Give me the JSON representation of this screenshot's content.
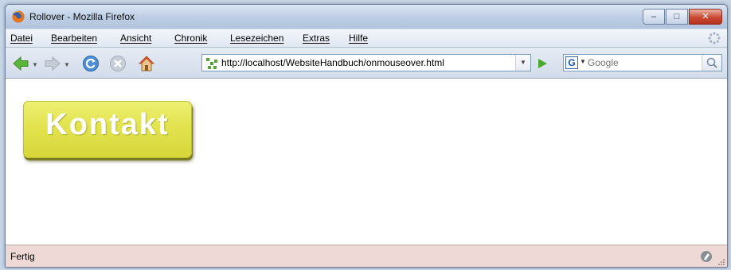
{
  "window": {
    "title": "Rollover - Mozilla Firefox",
    "controls": {
      "minimize": "–",
      "maximize": "□",
      "close": "✕"
    }
  },
  "menubar": {
    "items": [
      "Datei",
      "Bearbeiten",
      "Ansicht",
      "Chronik",
      "Lesezeichen",
      "Extras",
      "Hilfe"
    ]
  },
  "navbar": {
    "url": "http://localhost/WebsiteHandbuch/onmouseover.html",
    "search_engine_letter": "G",
    "search_placeholder": "Google"
  },
  "content": {
    "button_label": "Kontakt",
    "button_color": "#e3e34f"
  },
  "statusbar": {
    "text": "Fertig"
  },
  "icons": {
    "app": "firefox-icon",
    "back": "back-arrow-icon",
    "forward": "forward-arrow-icon",
    "reload": "reload-icon",
    "stop": "stop-icon",
    "home": "home-icon",
    "site": "site-favicon-icon",
    "go": "go-arrow-icon",
    "search": "magnifier-icon",
    "throbber": "throbber-icon",
    "status": "pencil-icon"
  }
}
